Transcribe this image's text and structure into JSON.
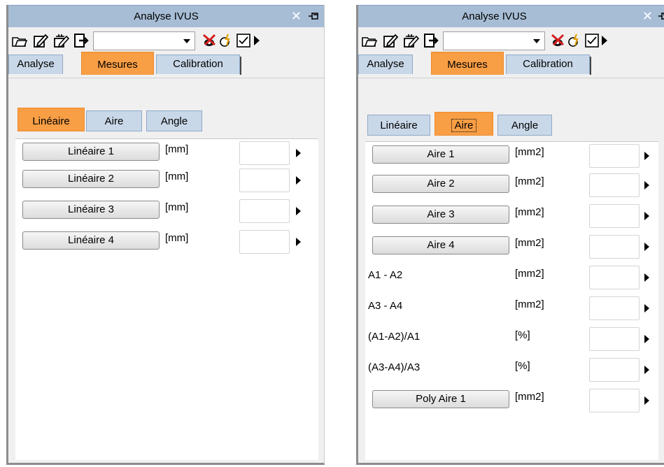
{
  "left": {
    "title": "Analyse IVUS",
    "tabs": [
      "Analyse",
      "Mesures",
      "Calibration"
    ],
    "active_tab": "Mesures",
    "subtabs": [
      "Linéaire",
      "Aire",
      "Angle"
    ],
    "active_subtab": "Linéaire",
    "rows": [
      {
        "button": "Linéaire 1",
        "unit": "[mm]",
        "value": ""
      },
      {
        "button": "Linéaire 2",
        "unit": "[mm]",
        "value": ""
      },
      {
        "button": "Linéaire 3",
        "unit": "[mm]",
        "value": ""
      },
      {
        "button": "Linéaire 4",
        "unit": "[mm]",
        "value": ""
      }
    ]
  },
  "right": {
    "title": "Analyse IVUS",
    "tabs": [
      "Analyse",
      "Mesures",
      "Calibration"
    ],
    "active_tab": "Mesures",
    "subtabs": [
      "Linéaire",
      "Aire",
      "Angle"
    ],
    "active_subtab": "Aire",
    "rows": [
      {
        "button": "Aire 1",
        "unit": "[mm2]",
        "value": ""
      },
      {
        "button": "Aire 2",
        "unit": "[mm2]",
        "value": ""
      },
      {
        "button": "Aire 3",
        "unit": "[mm2]",
        "value": ""
      },
      {
        "button": "Aire 4",
        "unit": "[mm2]",
        "value": ""
      },
      {
        "label": "A1 - A2",
        "unit": "[mm2]",
        "value": ""
      },
      {
        "label": "A3 - A4",
        "unit": "[mm2]",
        "value": ""
      },
      {
        "label": "(A1-A2)/A1",
        "unit": "[%]",
        "value": ""
      },
      {
        "label": "(A3-A4)/A3",
        "unit": "[%]",
        "value": ""
      },
      {
        "button": "Poly Aire 1",
        "unit": "[mm2]",
        "value": ""
      }
    ]
  },
  "toolbar_icons": [
    "open-folder-icon",
    "edit-note-icon",
    "edit-all-icon",
    "export-icon",
    "hide-overlay-icon",
    "auto-detect-icon",
    "checklist-icon"
  ],
  "colors": {
    "active_tab": "#f89e45",
    "inactive_tab": "#c9d8e8",
    "titlebar": "#a7bdd6"
  }
}
